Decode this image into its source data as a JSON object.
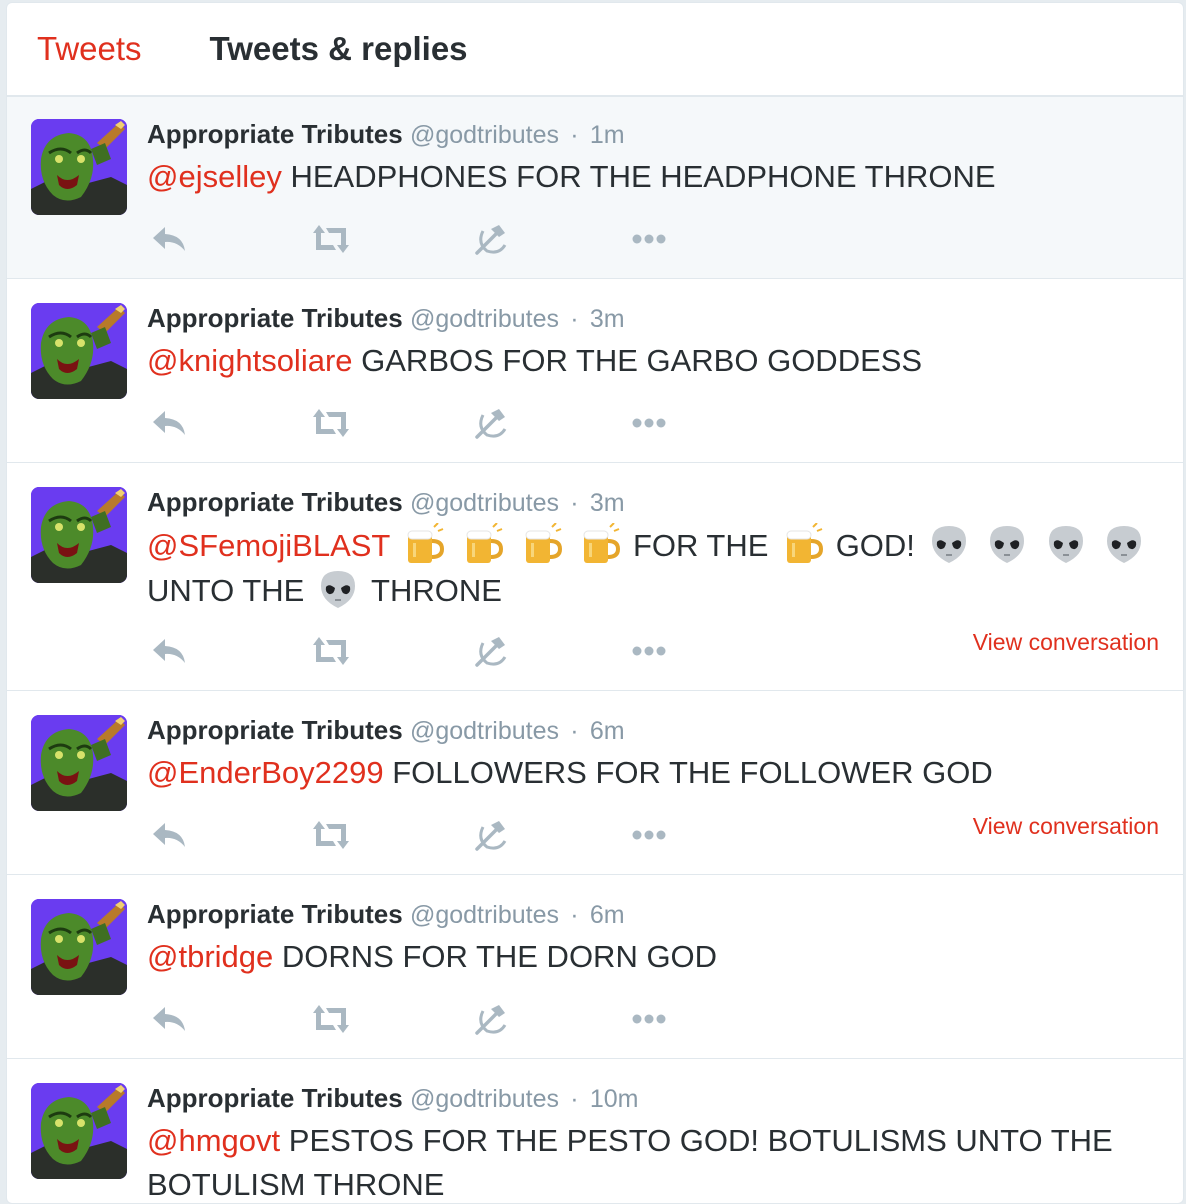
{
  "tabs": {
    "tweets": "Tweets",
    "replies": "Tweets & replies"
  },
  "colors": {
    "accent": "#e0301e",
    "muted": "#8899a6",
    "avatar_bg": "#6a3cf0"
  },
  "icons": [
    "reply-icon",
    "retweet-icon",
    "hammer-sickle-icon",
    "more-icon",
    "beer-mug-emoji",
    "alien-emoji"
  ],
  "tweets": [
    {
      "name": "Appropriate Tributes",
      "handle": "@godtributes",
      "time": "1m",
      "mention": "@ejselley",
      "text": "HEADPHONES FOR THE HEADPHONE THRONE"
    },
    {
      "name": "Appropriate Tributes",
      "handle": "@godtributes",
      "time": "3m",
      "mention": "@knightsoliare",
      "text": "GARBOS FOR THE GARBO GODDESS"
    },
    {
      "name": "Appropriate Tributes",
      "handle": "@godtributes",
      "time": "3m",
      "mention": "@SFemojiBLAST",
      "t1": "FOR THE",
      "t2": "GOD!",
      "t3": "UNTO THE",
      "t4": "THRONE",
      "view_conversation": "View conversation"
    },
    {
      "name": "Appropriate Tributes",
      "handle": "@godtributes",
      "time": "6m",
      "mention": "@EnderBoy2299",
      "text": "FOLLOWERS FOR THE FOLLOWER GOD",
      "view_conversation": "View conversation"
    },
    {
      "name": "Appropriate Tributes",
      "handle": "@godtributes",
      "time": "6m",
      "mention": "@tbridge",
      "text": "DORNS FOR THE DORN GOD"
    },
    {
      "name": "Appropriate Tributes",
      "handle": "@godtributes",
      "time": "10m",
      "mention": "@hmgovt",
      "text": "PESTOS FOR THE PESTO GOD! BOTULISMS UNTO THE BOTULISM THRONE"
    }
  ]
}
